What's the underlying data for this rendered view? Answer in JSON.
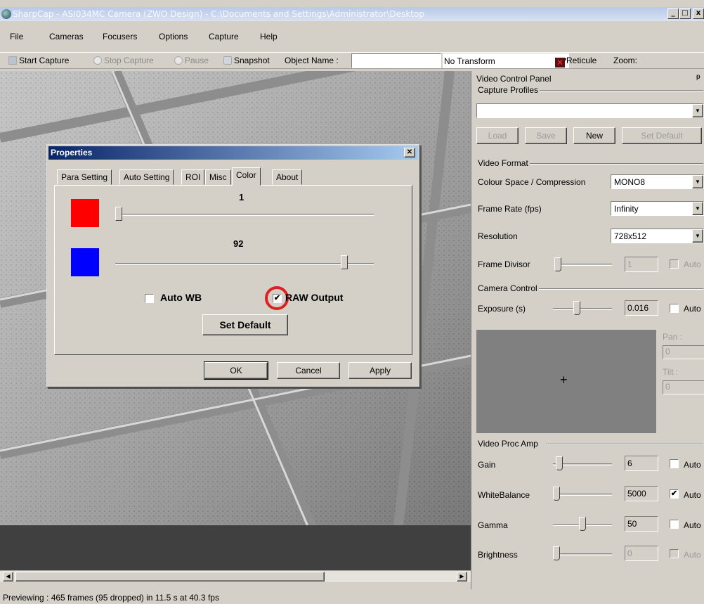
{
  "window": {
    "title": "SharpCap - ASI034MC Camera (ZWO Design) - C:\\Documents and Settings\\Administrator\\Desktop",
    "controls": [
      "_",
      "□",
      "x"
    ]
  },
  "menu": [
    "File",
    "Cameras",
    "Focusers",
    "Options",
    "Capture",
    "Help"
  ],
  "toolbar": {
    "start_capture": "Start Capture",
    "stop_capture": "Stop Capture",
    "pause": "Pause",
    "snapshot": "Snapshot",
    "object_name_label": "Object Name :",
    "object_name_value": "",
    "transform": "No Transform",
    "reticule": "Reticule",
    "zoom": "Zoom:"
  },
  "panel": {
    "title": "Video Control Panel",
    "capture_profiles": {
      "label": "Capture Profiles",
      "selected": "",
      "buttons": [
        "Load",
        "Save",
        "New",
        "Set Default"
      ]
    },
    "video_format": {
      "label": "Video Format",
      "colour_space_label": "Colour Space / Compression",
      "colour_space_value": "MONO8",
      "frame_rate_label": "Frame Rate (fps)",
      "frame_rate_value": "Infinity",
      "resolution_label": "Resolution",
      "resolution_value": "728x512",
      "frame_divisor_label": "Frame Divisor",
      "frame_divisor_value": "1",
      "frame_divisor_auto": "Auto"
    },
    "camera_control": {
      "label": "Camera Control",
      "exposure_label": "Exposure (s)",
      "exposure_value": "0.016",
      "exposure_auto": "Auto",
      "pan_label": "Pan :",
      "pan_value": "0",
      "tilt_label": "Tilt :",
      "tilt_value": "0",
      "crosshair": "+"
    },
    "proc_amp": {
      "label": "Video Proc Amp",
      "rows": [
        {
          "label": "Gain",
          "value": "6",
          "auto": "Auto",
          "checked": false,
          "enabled": true,
          "level": 0.05
        },
        {
          "label": "WhiteBalance",
          "value": "5000",
          "auto": "Auto",
          "checked": true,
          "enabled": true,
          "level": 0.0
        },
        {
          "label": "Gamma",
          "value": "50",
          "auto": "Auto",
          "checked": false,
          "enabled": true,
          "level": 0.5
        },
        {
          "label": "Brightness",
          "value": "0",
          "auto": "Auto",
          "checked": false,
          "enabled": false,
          "level": 0.0
        }
      ]
    }
  },
  "dialog": {
    "title": "Properties",
    "tabs": [
      "Para Setting",
      "Auto Setting",
      "ROI",
      "Misc",
      "Color",
      "About"
    ],
    "active_tab": "Color",
    "red_value": "1",
    "blue_value": "92",
    "red_level": 0.0,
    "blue_level": 0.9,
    "auto_wb_label": "Auto WB",
    "auto_wb_checked": false,
    "raw_output_label": "RAW Output",
    "raw_output_checked": true,
    "set_default": "Set Default",
    "ok": "OK",
    "cancel": "Cancel",
    "apply": "Apply",
    "colors": {
      "red": "#ff0000",
      "blue": "#0000ff",
      "highlight": "#e02020"
    }
  },
  "status": "Previewing : 465 frames (95 dropped) in 11.5 s at 40.3 fps"
}
